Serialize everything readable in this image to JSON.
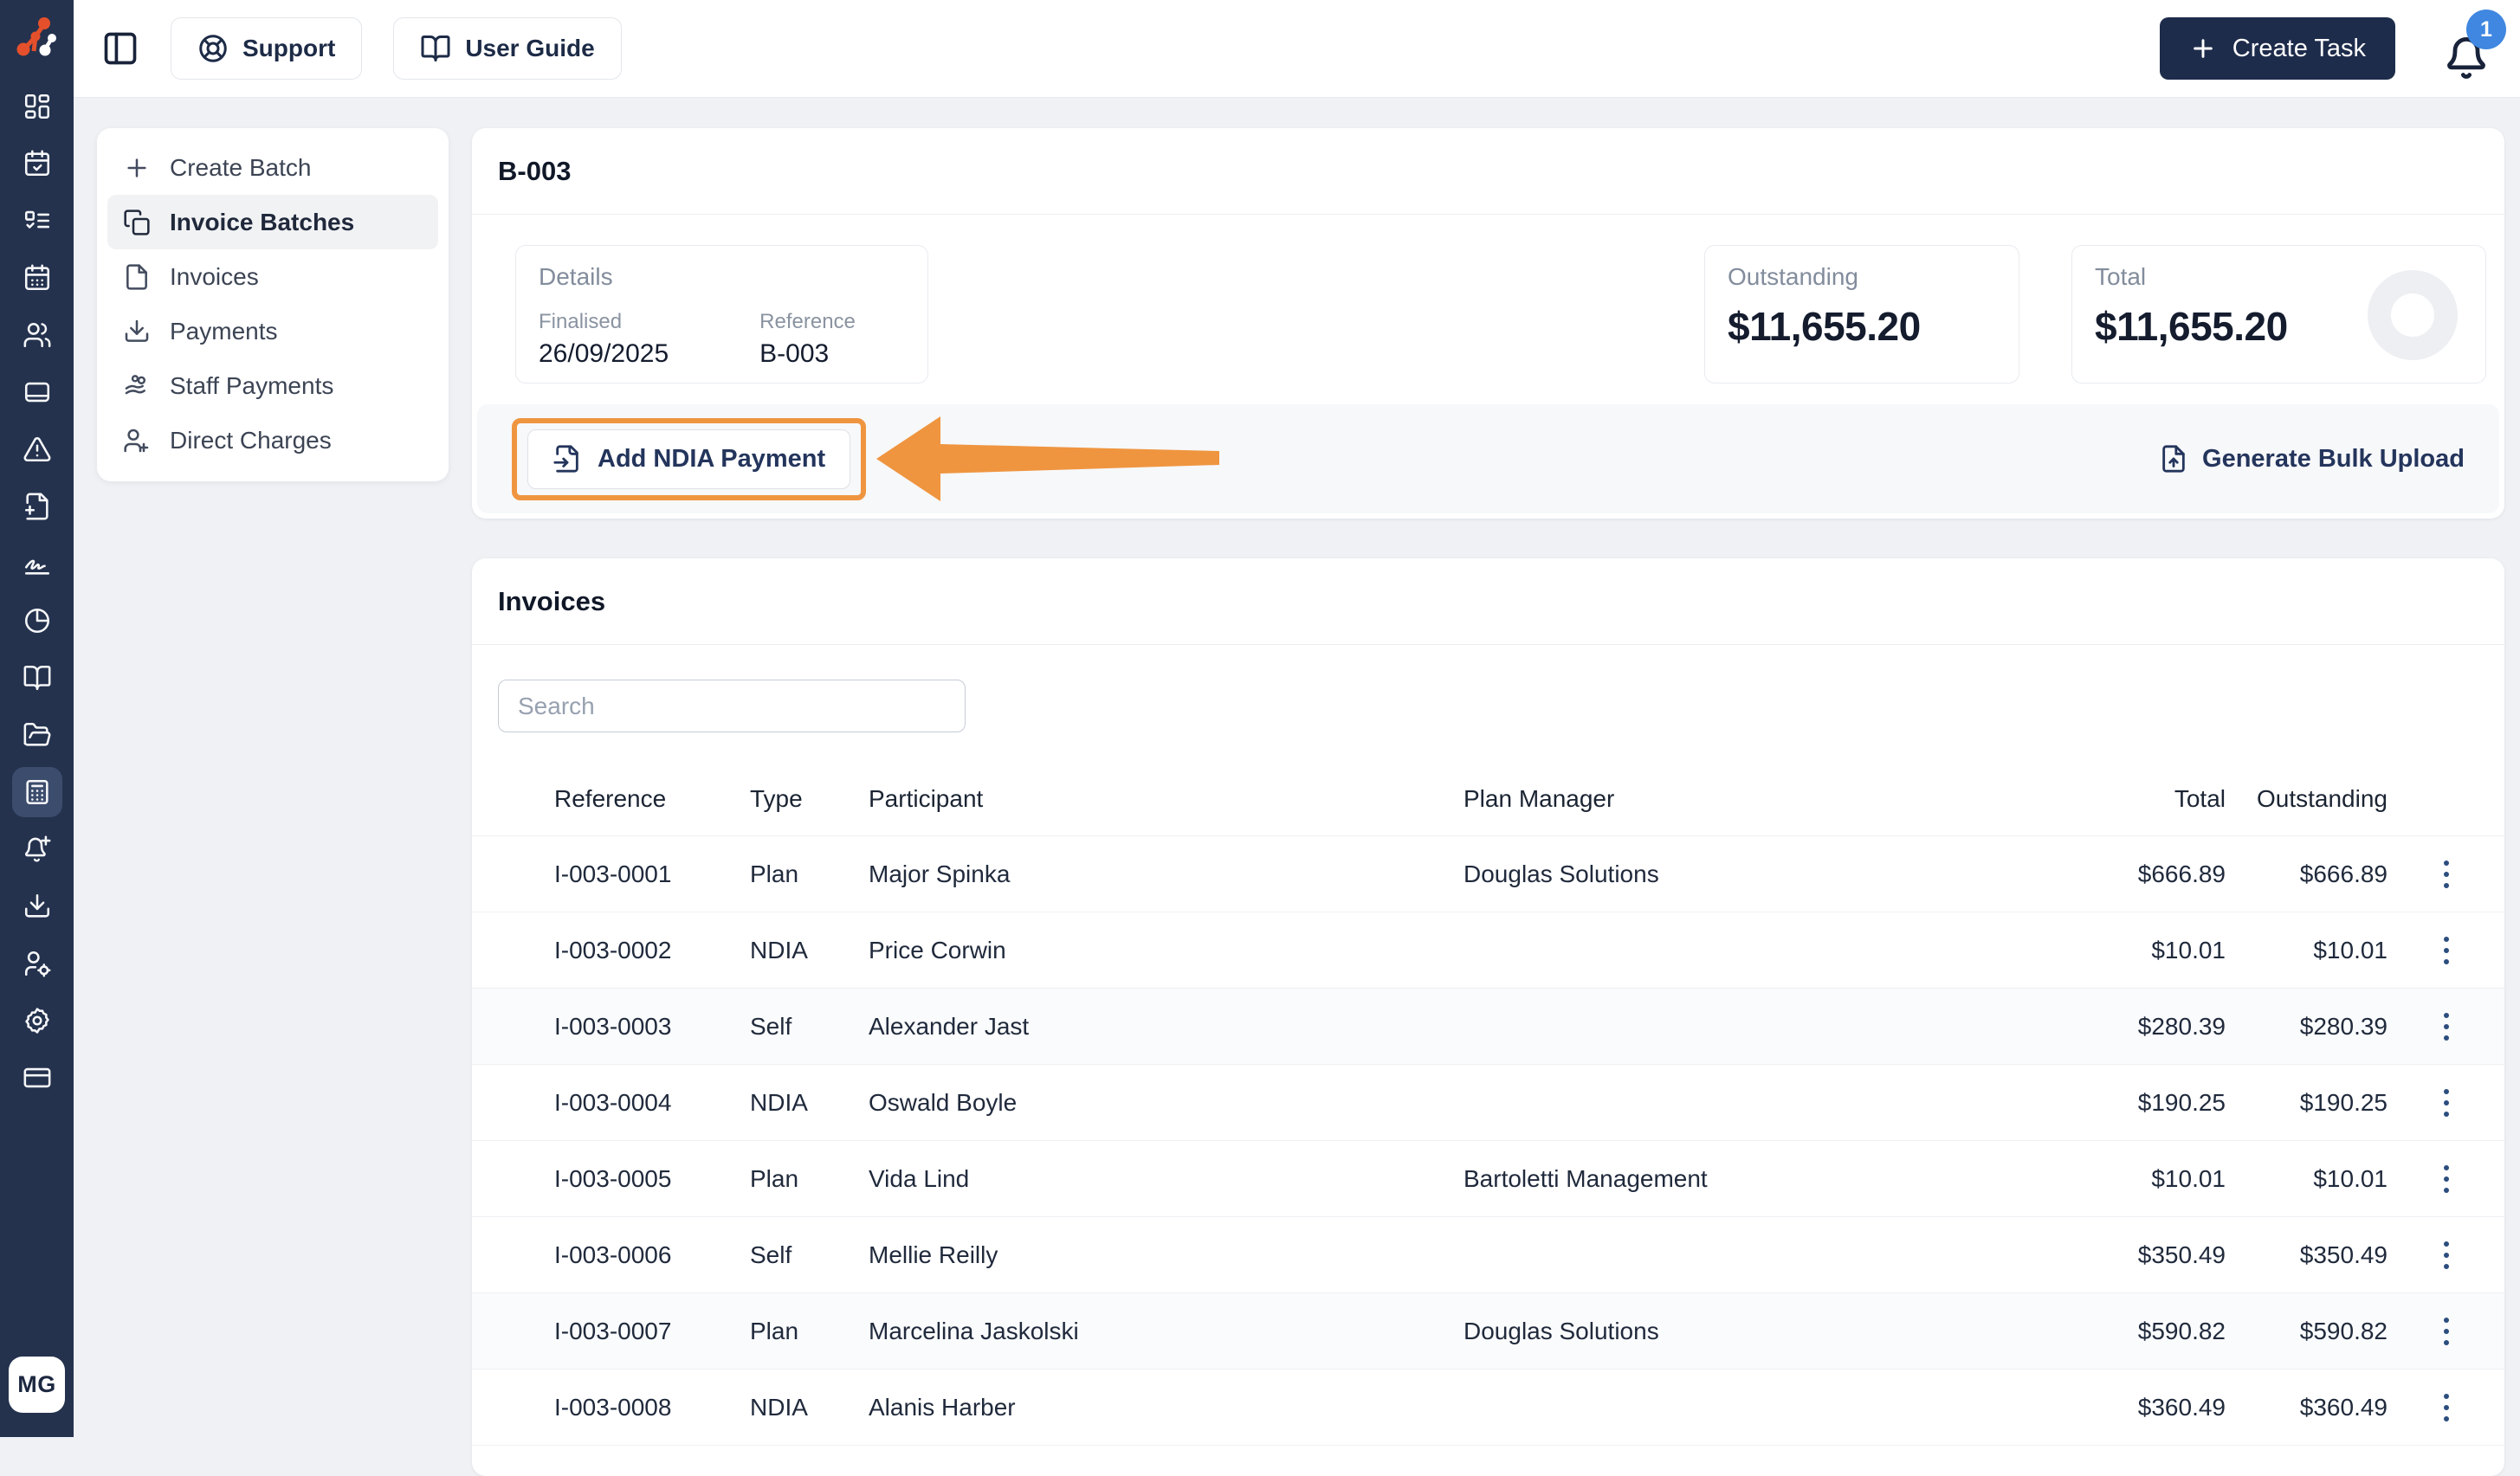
{
  "topbar": {
    "support_label": "Support",
    "user_guide_label": "User Guide",
    "create_task_label": "Create Task",
    "notification_count": "1"
  },
  "rail": {
    "icons": [
      "dashboard",
      "calendar-check",
      "list-todo",
      "calendar",
      "users",
      "notebook",
      "alert-triangle",
      "file-plus",
      "signature",
      "chart-pie",
      "book-open",
      "folder-open",
      "invoices",
      "bell-plus",
      "download",
      "user-gear",
      "settings",
      "credit-card"
    ],
    "active_icon": "invoices",
    "avatar_initials": "MG"
  },
  "sidebar": {
    "items": [
      {
        "label": "Create Batch",
        "icon": "plus"
      },
      {
        "label": "Invoice Batches",
        "icon": "copy",
        "active": true
      },
      {
        "label": "Invoices",
        "icon": "file"
      },
      {
        "label": "Payments",
        "icon": "download"
      },
      {
        "label": "Staff Payments",
        "icon": "hand-coins"
      },
      {
        "label": "Direct Charges",
        "icon": "user-plus"
      }
    ]
  },
  "batch": {
    "title": "B-003",
    "details": {
      "heading": "Details",
      "finalised_label": "Finalised",
      "finalised_value": "26/09/2025",
      "reference_label": "Reference",
      "reference_value": "B-003"
    },
    "outstanding": {
      "label": "Outstanding",
      "value": "$11,655.20"
    },
    "total": {
      "label": "Total",
      "value": "$11,655.20"
    },
    "actions": {
      "add_ndia_payment": "Add NDIA Payment",
      "generate_bulk_upload": "Generate Bulk Upload"
    }
  },
  "invoices": {
    "title": "Invoices",
    "search_placeholder": "Search",
    "table": {
      "columns": [
        "Reference",
        "Type",
        "Participant",
        "Plan Manager",
        "Total",
        "Outstanding"
      ],
      "rows": [
        {
          "reference": "I-003-0001",
          "type": "Plan",
          "participant": "Major Spinka",
          "plan_manager": "Douglas Solutions",
          "total": "$666.89",
          "outstanding": "$666.89"
        },
        {
          "reference": "I-003-0002",
          "type": "NDIA",
          "participant": "Price Corwin",
          "plan_manager": "",
          "total": "$10.01",
          "outstanding": "$10.01"
        },
        {
          "reference": "I-003-0003",
          "type": "Self",
          "participant": "Alexander Jast",
          "plan_manager": "",
          "total": "$280.39",
          "outstanding": "$280.39"
        },
        {
          "reference": "I-003-0004",
          "type": "NDIA",
          "participant": "Oswald Boyle",
          "plan_manager": "",
          "total": "$190.25",
          "outstanding": "$190.25"
        },
        {
          "reference": "I-003-0005",
          "type": "Plan",
          "participant": "Vida Lind",
          "plan_manager": "Bartoletti Management",
          "total": "$10.01",
          "outstanding": "$10.01"
        },
        {
          "reference": "I-003-0006",
          "type": "Self",
          "participant": "Mellie Reilly",
          "plan_manager": "",
          "total": "$350.49",
          "outstanding": "$350.49"
        },
        {
          "reference": "I-003-0007",
          "type": "Plan",
          "participant": "Marcelina Jaskolski",
          "plan_manager": "Douglas Solutions",
          "total": "$590.82",
          "outstanding": "$590.82"
        },
        {
          "reference": "I-003-0008",
          "type": "NDIA",
          "participant": "Alanis Harber",
          "plan_manager": "",
          "total": "$360.49",
          "outstanding": "$360.49"
        }
      ]
    }
  },
  "colors": {
    "rail_navy": "#24324e",
    "button_navy": "#1e2c4b",
    "annotation_orange": "#ef9540",
    "logo_orange": "#e4502b",
    "badge_blue": "#3f87e0",
    "page_background": "#eff1f4"
  }
}
